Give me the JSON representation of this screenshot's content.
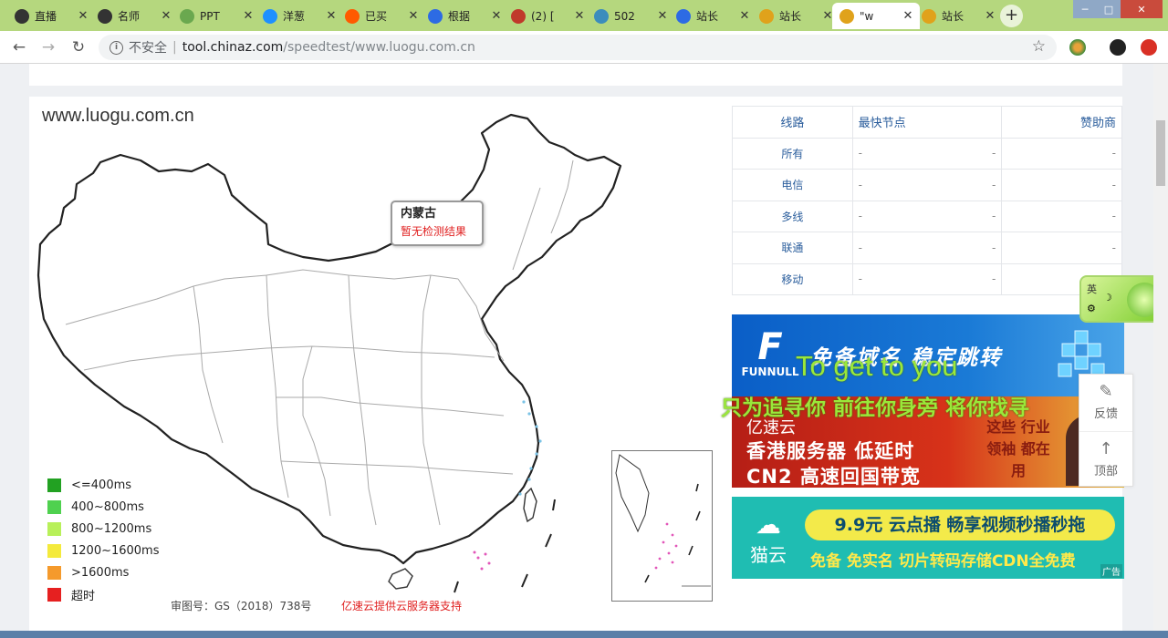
{
  "browser": {
    "tabs": [
      {
        "label": "直播",
        "icon": "globe-icon",
        "color": "#333333"
      },
      {
        "label": "名师",
        "icon": "globe-icon",
        "color": "#333333"
      },
      {
        "label": "PPT",
        "icon": "ppt-site-icon",
        "color": "#6aa84f"
      },
      {
        "label": "洋葱",
        "icon": "onion-icon",
        "color": "#1e90ff"
      },
      {
        "label": "已买",
        "icon": "taobao-icon",
        "color": "#ff5a00"
      },
      {
        "label": "根据",
        "icon": "baidu-paw-icon",
        "color": "#2d6be4"
      },
      {
        "label": "(2) [",
        "icon": "colorful-game-icon",
        "color": "#c0392b"
      },
      {
        "label": "502",
        "icon": "page-error-icon",
        "color": "#3c8dbc"
      },
      {
        "label": "站长",
        "icon": "baidu-paw-icon",
        "color": "#2d6be4"
      },
      {
        "label": "站长",
        "icon": "chinaz-icon",
        "color": "#e0a21b"
      },
      {
        "label": "\"w",
        "icon": "chinaz-icon",
        "color": "#e0a21b"
      },
      {
        "label": "站长",
        "icon": "chinaz-icon",
        "color": "#e0a21b"
      }
    ],
    "active_tab_index": 10,
    "new_tab_label": "+",
    "address": {
      "security_label": "不安全",
      "host": "tool.chinaz.com",
      "path": "/speedtest/www.luogu.com.cn"
    }
  },
  "page": {
    "site_title": "www.luogu.com.cn",
    "tooltip": {
      "title": "内蒙古",
      "status": "暂无检测结果"
    },
    "legend": [
      {
        "label": "<=400ms",
        "color": "#22a122"
      },
      {
        "label": "400~800ms",
        "color": "#4fd14f"
      },
      {
        "label": "800~1200ms",
        "color": "#b8f05a"
      },
      {
        "label": "1200~1600ms",
        "color": "#f4ea3c"
      },
      {
        "label": ">1600ms",
        "color": "#f59a2c"
      },
      {
        "label": "超时",
        "color": "#e62020"
      }
    ],
    "map_footer": "审图号：GS（2018）738号",
    "map_footer_sponsor": "亿速云提供云服务器支持",
    "table": {
      "headers": [
        "线路",
        "最快节点",
        "赞助商"
      ],
      "rows": [
        {
          "line": "所有",
          "node": "-",
          "node2": "-",
          "sponsor": "-"
        },
        {
          "line": "电信",
          "node": "-",
          "node2": "-",
          "sponsor": "-"
        },
        {
          "line": "多线",
          "node": "-",
          "node2": "-",
          "sponsor": "-"
        },
        {
          "line": "联通",
          "node": "-",
          "node2": "-",
          "sponsor": "-"
        },
        {
          "line": "移动",
          "node": "-",
          "node2": "-",
          "sponsor": "-"
        }
      ]
    },
    "ads": {
      "ad1": {
        "brand": "FUNNULL",
        "headline": "免备域名 稳定跳转"
      },
      "ad2": {
        "brand": "亿速云",
        "line1": "香港服务器 低延时",
        "line2": "CN2 高速回国带宽",
        "side": "这些 行业领袖 都在用"
      },
      "ad3": {
        "brand": "猫云",
        "headline": "9.9元 云点播 畅享视频秒播秒拖",
        "sub": "免备 免实名 切片转码存储CDN全免费",
        "tag": "广告"
      }
    },
    "lyrics": {
      "line1": "To get to you",
      "line2": "只为追寻你 前往你身旁 将你找寻"
    },
    "side_actions": {
      "feedback": "反馈",
      "top": "顶部"
    },
    "float_widget_label": "英"
  }
}
